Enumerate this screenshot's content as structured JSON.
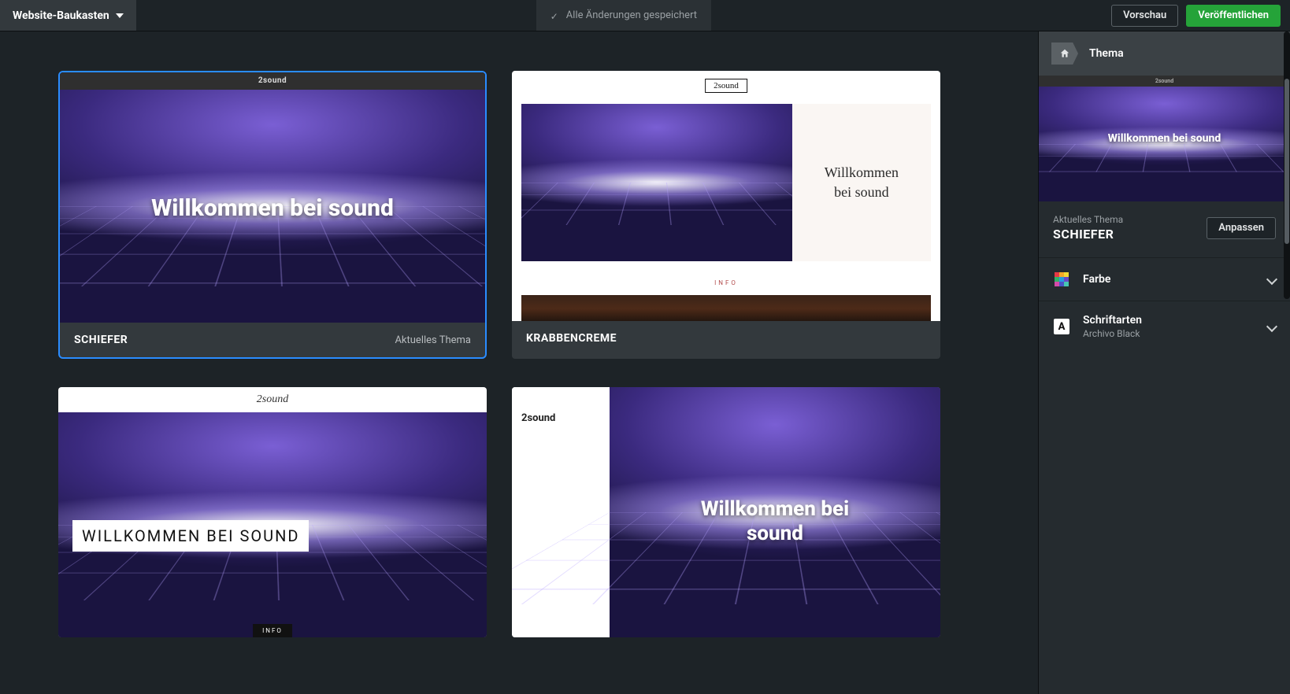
{
  "topbar": {
    "app_menu": "Website-Baukasten",
    "status": "Alle Änderungen gespeichert",
    "preview_btn": "Vorschau",
    "publish_btn": "Veröffentlichen"
  },
  "themes": [
    {
      "name": "SCHIEFER",
      "badge": "Aktuelles Thema",
      "brand": "2sound",
      "hero": "Willkommen bei sound",
      "selected": true
    },
    {
      "name": "KRABBENCREME",
      "brand": "2sound",
      "hero_line1": "Willkommen",
      "hero_line2": "bei sound",
      "info_label": "INFO"
    },
    {
      "brand": "2sound",
      "hero": "WILLKOMMEN BEI SOUND",
      "info_tag": "INFO"
    },
    {
      "brand": "2sound",
      "hero_line1": "Willkommen bei",
      "hero_line2": "sound"
    }
  ],
  "sidepanel": {
    "crumb": "Thema",
    "preview_brand": "2sound",
    "preview_hero": "Willkommen bei sound",
    "current_label": "Aktuelles Thema",
    "current_name": "SCHIEFER",
    "customize_btn": "Anpassen",
    "rows": {
      "color": {
        "title": "Farbe"
      },
      "fonts": {
        "title": "Schriftarten",
        "subtitle": "Archivo Black",
        "badge": "A"
      }
    }
  }
}
